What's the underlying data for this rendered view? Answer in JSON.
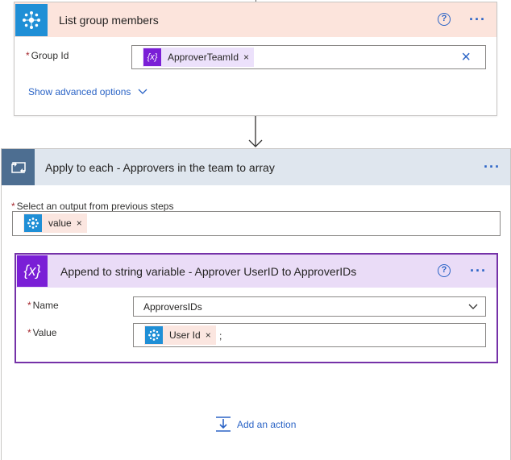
{
  "list_group": {
    "title": "List group members",
    "help_icon": "?",
    "more_icon": "···",
    "group_id_label": "Group Id",
    "group_id_token": "ApproverTeamId",
    "group_id_token_icon": "{x}",
    "token_remove": "×",
    "clear_icon": "×",
    "advanced_link": "Show advanced options",
    "advanced_chevron": "⌵"
  },
  "apply_each": {
    "title": "Apply to each - Approvers in the team to array",
    "more_icon": "···",
    "select_label": "Select an output from previous steps",
    "value_token": "value",
    "token_remove": "×"
  },
  "append_var": {
    "title": "Append to string variable - Approver UserID to ApproverIDs",
    "icon_text": "{x}",
    "help_icon": "?",
    "more_icon": "···",
    "name_label": "Name",
    "name_value": "ApproversIDs",
    "value_label": "Value",
    "value_token": "User Id",
    "token_remove": "×",
    "value_suffix": ";"
  },
  "add_action": {
    "label": "Add an action"
  },
  "colors": {
    "accent_blue": "#2b64c6",
    "connector_pink": "#fce4dc",
    "loop_header": "#dfe6ee",
    "variable_purple": "#7a1fd6"
  }
}
